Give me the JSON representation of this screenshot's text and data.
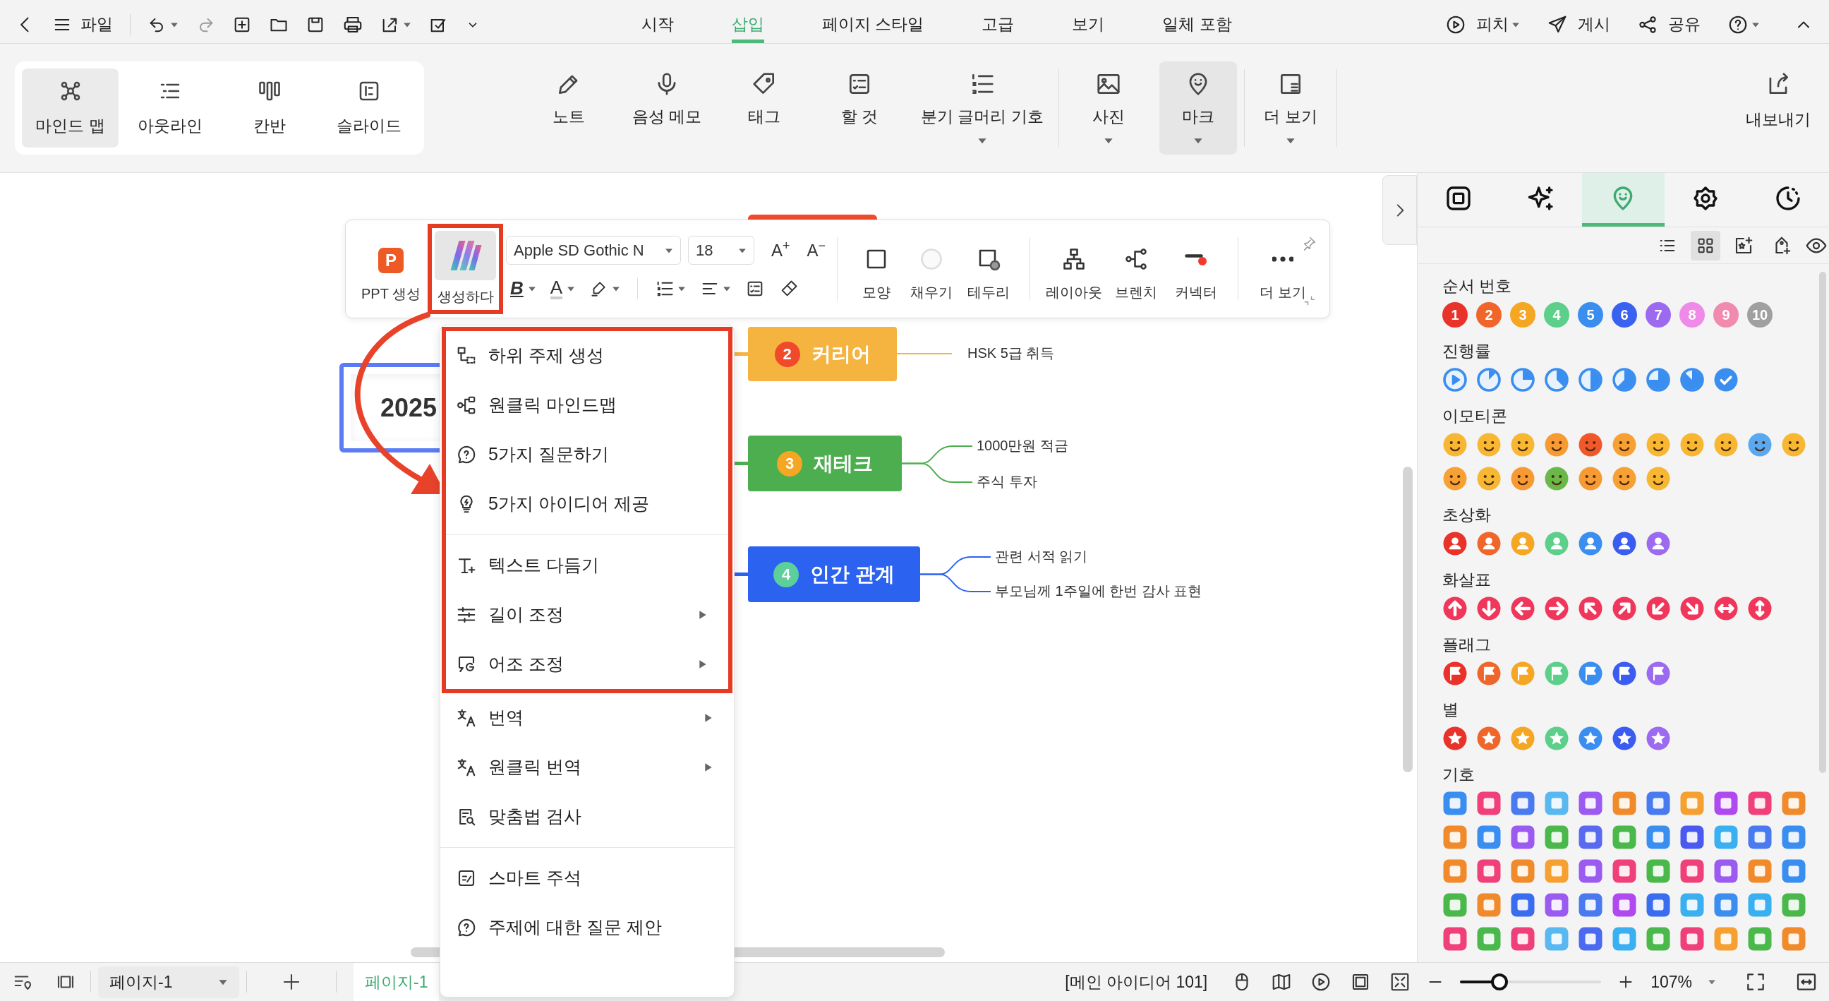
{
  "menubar": {
    "file_label": "파일",
    "tabs": [
      {
        "label": "시작",
        "selected": false
      },
      {
        "label": "삽입",
        "selected": true
      },
      {
        "label": "페이지 스타일",
        "selected": false
      },
      {
        "label": "고급",
        "selected": false
      },
      {
        "label": "보기",
        "selected": false
      },
      {
        "label": "일체 포함",
        "selected": false
      }
    ],
    "actions": [
      {
        "label": "피치",
        "kind": "pitch",
        "dropdown": true
      },
      {
        "label": "게시",
        "kind": "publish",
        "dropdown": false
      },
      {
        "label": "공유",
        "kind": "share",
        "dropdown": false
      }
    ]
  },
  "ribbon": {
    "views": [
      {
        "label": "마인드 맵",
        "kind": "mindmap",
        "selected": true
      },
      {
        "label": "아웃라인",
        "kind": "outline",
        "selected": false
      },
      {
        "label": "칸반",
        "kind": "kanban",
        "selected": false
      },
      {
        "label": "슬라이드",
        "kind": "slide",
        "selected": false
      }
    ],
    "tool_groups": [
      [
        {
          "label": "노트",
          "kind": "note",
          "dropdown": false,
          "selected": false
        },
        {
          "label": "음성 메모",
          "kind": "voice",
          "dropdown": false,
          "selected": false
        },
        {
          "label": "태그",
          "kind": "tag",
          "dropdown": false,
          "selected": false
        },
        {
          "label": "할 것",
          "kind": "todo",
          "dropdown": false,
          "selected": false
        },
        {
          "label": "분기 글머리 기호",
          "kind": "bullet",
          "dropdown": true,
          "selected": false
        }
      ],
      [
        {
          "label": "사진",
          "kind": "photo",
          "dropdown": true,
          "selected": false
        },
        {
          "label": "마크",
          "kind": "mark",
          "dropdown": true,
          "selected": true
        }
      ],
      [
        {
          "label": "더 보기",
          "kind": "more",
          "dropdown": true,
          "selected": false
        }
      ]
    ],
    "export_label": "내보내기"
  },
  "format_toolbar": {
    "ppt_badge": "P",
    "ppt_label": "PPT 생성",
    "ai_button": {
      "label": "생성하다",
      "selected": true,
      "highlighted": true
    },
    "font": "Apple SD Gothic N",
    "size": "18",
    "grow_font": "A$^{+}$",
    "shrink_font": "A$^{−}$",
    "bold_label": "B",
    "color_label": "A",
    "tool_groups": [
      [
        {
          "label": "모양",
          "kind": "shape"
        },
        {
          "label": "채우기",
          "kind": "fill"
        },
        {
          "label": "테두리",
          "kind": "border"
        }
      ],
      [
        {
          "label": "레이아웃",
          "kind": "layout"
        },
        {
          "label": "브렌치",
          "kind": "branch"
        },
        {
          "label": "커넥터",
          "kind": "connector"
        }
      ],
      [
        {
          "label": "더 보기",
          "kind": "more"
        }
      ]
    ]
  },
  "context_menu": {
    "items": [
      {
        "label": "하위 주제 생성",
        "kind": "subtopic",
        "submenu": false,
        "highlighted": true,
        "divider_before": false
      },
      {
        "label": "원클릭 마인드맵",
        "kind": "mindmap",
        "submenu": false,
        "highlighted": true,
        "divider_before": false
      },
      {
        "label": "5가지 질문하기",
        "kind": "question",
        "submenu": false,
        "highlighted": true,
        "divider_before": false
      },
      {
        "label": "5가지 아이디어 제공",
        "kind": "idea",
        "submenu": false,
        "highlighted": true,
        "divider_before": false
      },
      {
        "label": "텍스트 다듬기",
        "kind": "polish",
        "submenu": false,
        "highlighted": true,
        "divider_before": true
      },
      {
        "label": "길이 조정",
        "kind": "length",
        "submenu": true,
        "highlighted": true,
        "divider_before": false
      },
      {
        "label": "어조 조정",
        "kind": "tone",
        "submenu": true,
        "highlighted": true,
        "divider_before": false
      },
      {
        "label": "번역",
        "kind": "translate",
        "submenu": true,
        "highlighted": false,
        "divider_before": false
      },
      {
        "label": "원클릭 번역",
        "kind": "translate",
        "submenu": true,
        "highlighted": false,
        "divider_before": false
      },
      {
        "label": "맞춤법 검사",
        "kind": "spellcheck",
        "submenu": false,
        "highlighted": false,
        "divider_before": false
      },
      {
        "label": "스마트 주석",
        "kind": "annotate",
        "submenu": false,
        "highlighted": false,
        "divider_before": true
      },
      {
        "label": "주제에 대한 질문 제안",
        "kind": "question",
        "submenu": false,
        "highlighted": false,
        "divider_before": false
      }
    ]
  },
  "mind_map": {
    "root": "2025",
    "branches": [
      {
        "label": "커리어",
        "badge": {
          "text": "2",
          "color": "#f04a2a"
        },
        "color": "#f5b33f",
        "children": [
          "HSK 5급 취득"
        ]
      },
      {
        "label": "재테크",
        "badge": {
          "text": "3",
          "color": "#f5a623"
        },
        "color": "#4cae4f",
        "children": [
          "1000만원 적금",
          "주식 투자"
        ]
      },
      {
        "label": "인간 관계",
        "badge": {
          "text": "4",
          "color": "#5ccf9a"
        },
        "color": "#2b63f0",
        "children": [
          "관련 서적 읽기",
          "부모님께 1주일에 한번 감사 표현"
        ]
      }
    ]
  },
  "mark_panel": {
    "tabs": [
      {
        "kind": "box",
        "selected": false
      },
      {
        "kind": "sparkle",
        "selected": false
      },
      {
        "kind": "mark",
        "selected": true
      },
      {
        "kind": "flower",
        "selected": false
      },
      {
        "kind": "clock",
        "selected": false
      }
    ],
    "view_modes": [
      {
        "kind": "list",
        "selected": false
      },
      {
        "kind": "grid",
        "selected": true
      }
    ],
    "sections": [
      {
        "title": "순서 번호",
        "kind": "number",
        "items": [
          {
            "text": "1",
            "color": "#e8322a"
          },
          {
            "text": "2",
            "color": "#f0662a"
          },
          {
            "text": "3",
            "color": "#f5a623"
          },
          {
            "text": "4",
            "color": "#5ccf8a"
          },
          {
            "text": "5",
            "color": "#3a8ef0"
          },
          {
            "text": "6",
            "color": "#3a62f0"
          },
          {
            "text": "7",
            "color": "#9b6af0"
          },
          {
            "text": "8",
            "color": "#f08ae8"
          },
          {
            "text": "9",
            "color": "#f08aaf"
          },
          {
            "text": "10",
            "color": "#a0a0a0"
          }
        ]
      },
      {
        "title": "진행률",
        "kind": "progress",
        "items": [
          {
            "kind": "start"
          },
          {
            "kind": "one-eighth"
          },
          {
            "kind": "quarter"
          },
          {
            "kind": "three-eighths"
          },
          {
            "kind": "half"
          },
          {
            "kind": "five-eighths"
          },
          {
            "kind": "three-quarters"
          },
          {
            "kind": "seven-eighths"
          },
          {
            "kind": "done"
          }
        ]
      },
      {
        "title": "이모티콘",
        "kind": "emoticon",
        "items": [
          {
            "color": "#f7b733"
          },
          {
            "color": "#f7b733"
          },
          {
            "color": "#f7b733"
          },
          {
            "color": "#f79a33"
          },
          {
            "color": "#f0582a"
          },
          {
            "color": "#f7a033"
          },
          {
            "color": "#f7b733"
          },
          {
            "color": "#f7b733"
          },
          {
            "color": "#f7b733"
          },
          {
            "color": "#5aa8f0"
          },
          {
            "color": "#f7b733"
          },
          {
            "color": "#f7a033"
          },
          {
            "color": "#f7b733"
          },
          {
            "color": "#f79a33"
          },
          {
            "color": "#6bb84a"
          },
          {
            "color": "#f79a33"
          },
          {
            "color": "#f7a033"
          },
          {
            "color": "#f7b733"
          }
        ]
      },
      {
        "title": "초상화",
        "kind": "portrait",
        "items": [
          {
            "color": "#e8322a"
          },
          {
            "color": "#f0662a"
          },
          {
            "color": "#f5a623"
          },
          {
            "color": "#5ccf8a"
          },
          {
            "color": "#3a8ef0"
          },
          {
            "color": "#3a5cf0"
          },
          {
            "color": "#9b6af0"
          }
        ]
      },
      {
        "title": "화살표",
        "kind": "arrow",
        "items": [
          {
            "kind": "up",
            "color": "#f0365a"
          },
          {
            "kind": "down",
            "color": "#f0365a"
          },
          {
            "kind": "left",
            "color": "#f0365a"
          },
          {
            "kind": "right",
            "color": "#f0365a"
          },
          {
            "kind": "up-left",
            "color": "#f0365a"
          },
          {
            "kind": "up-right",
            "color": "#f0365a"
          },
          {
            "kind": "down-left",
            "color": "#f0365a"
          },
          {
            "kind": "down-right",
            "color": "#f0365a"
          },
          {
            "kind": "left-right",
            "color": "#f0365a"
          },
          {
            "kind": "up-down",
            "color": "#f0365a"
          }
        ]
      },
      {
        "title": "플래그",
        "kind": "flag",
        "items": [
          {
            "color": "#e8322a"
          },
          {
            "color": "#f0662a"
          },
          {
            "color": "#f5a623"
          },
          {
            "color": "#5ccf8a"
          },
          {
            "color": "#3a8ef0"
          },
          {
            "color": "#3a5cf0"
          },
          {
            "color": "#9b6af0"
          }
        ]
      },
      {
        "title": "별",
        "kind": "star",
        "items": [
          {
            "color": "#e8322a"
          },
          {
            "color": "#f0662a"
          },
          {
            "color": "#f5a623"
          },
          {
            "color": "#5ccf8a"
          },
          {
            "color": "#3a8ef0"
          },
          {
            "color": "#3a5cf0"
          },
          {
            "color": "#9b6af0"
          }
        ]
      },
      {
        "title": "기호",
        "kind": "symbol",
        "items": [
          {
            "color": "#3a8ef0"
          },
          {
            "color": "#f0407a"
          },
          {
            "color": "#4a7af0"
          },
          {
            "color": "#5ab8f0"
          },
          {
            "color": "#9b5af0"
          },
          {
            "color": "#f08a2a"
          },
          {
            "color": "#4a7af0"
          },
          {
            "color": "#f5a030"
          },
          {
            "color": "#b04af0"
          },
          {
            "color": "#f0407a"
          },
          {
            "color": "#f08a2a"
          },
          {
            "color": "#f08a2a"
          },
          {
            "color": "#3a8ef0"
          },
          {
            "color": "#9b5af0"
          },
          {
            "color": "#4ab84a"
          },
          {
            "color": "#5a6af0"
          },
          {
            "color": "#4ab84a"
          },
          {
            "color": "#3a8ef0"
          },
          {
            "color": "#4a5af0"
          },
          {
            "color": "#3ab0f0"
          },
          {
            "color": "#4a7af0"
          },
          {
            "color": "#3a8ef0"
          },
          {
            "color": "#f08a2a"
          },
          {
            "color": "#f0407a"
          },
          {
            "color": "#f08a2a"
          },
          {
            "color": "#f5a030"
          },
          {
            "color": "#9b5af0"
          },
          {
            "color": "#f0407a"
          },
          {
            "color": "#4ab84a"
          },
          {
            "color": "#f0407a"
          },
          {
            "color": "#9b5af0"
          },
          {
            "color": "#f08a2a"
          },
          {
            "color": "#3a8ef0"
          },
          {
            "color": "#4ab84a"
          },
          {
            "color": "#f08a2a"
          },
          {
            "color": "#3a6cf0"
          },
          {
            "color": "#9b5af0"
          },
          {
            "color": "#4a7af0"
          },
          {
            "color": "#b04af0"
          },
          {
            "color": "#3a6cf0"
          },
          {
            "color": "#3ab0f0"
          },
          {
            "color": "#3a8ef0"
          },
          {
            "color": "#3ab0f0"
          },
          {
            "color": "#4ab84a"
          },
          {
            "color": "#f0407a"
          },
          {
            "color": "#4ab84a"
          },
          {
            "color": "#f0407a"
          },
          {
            "color": "#5ab8f0"
          },
          {
            "color": "#4a6af0"
          },
          {
            "color": "#3ab0f0"
          },
          {
            "color": "#4ab84a"
          },
          {
            "color": "#f0407a"
          },
          {
            "color": "#f5a030"
          },
          {
            "color": "#4ab84a"
          },
          {
            "color": "#f08a2a"
          }
        ]
      }
    ]
  },
  "status_bar": {
    "page_select": "페이지-1",
    "pages": [
      {
        "label": "페이지-1",
        "selected": true
      }
    ],
    "topic_count": "[메인 아이디어 101]",
    "zoom": {
      "level": 0.28
    },
    "zoom_label": "107%"
  }
}
